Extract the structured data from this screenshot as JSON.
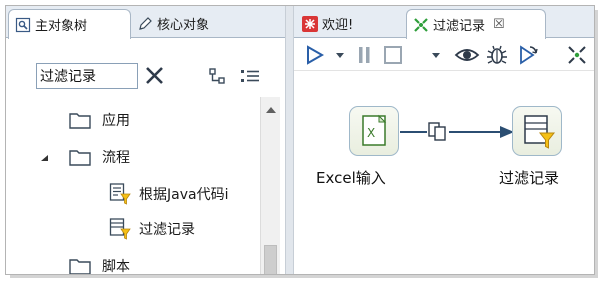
{
  "left_panel": {
    "tabs": [
      {
        "label": "主对象树",
        "icon": "main-tree-icon"
      },
      {
        "label": "核心对象",
        "icon": "pencil-icon"
      }
    ],
    "search": {
      "value": "过滤记录",
      "clear_icon": "close-icon"
    },
    "toolbar_icons": [
      "hierarchy-icon",
      "list-icon"
    ],
    "tree": [
      {
        "label": "应用",
        "icon": "folder-icon"
      },
      {
        "label": "流程",
        "icon": "folder-icon",
        "expanded": true
      },
      {
        "label": "根据Java代码i",
        "icon": "java-filter-step-icon"
      },
      {
        "label": "过滤记录",
        "icon": "filter-rows-step-icon"
      },
      {
        "label": "脚本",
        "icon": "folder-icon"
      }
    ]
  },
  "right_panel": {
    "tabs": [
      {
        "label": "欢迎!",
        "icon": "welcome-icon"
      },
      {
        "label": "过滤记录",
        "icon": "transformation-icon",
        "close_glyph": "☒"
      }
    ],
    "toolbar_icons": [
      "run-icon",
      "run-dropdown-icon",
      "pause-icon",
      "stop-icon",
      "stop-dropdown-icon",
      "preview-icon",
      "debug-icon",
      "replay-icon",
      "explore-icon"
    ],
    "canvas": {
      "steps": [
        {
          "label": "Excel输入",
          "icon": "excel-input-icon"
        },
        {
          "label": "过滤记录",
          "icon": "filter-rows-icon"
        }
      ],
      "hop": {
        "icon": "copy-rows-icon"
      }
    }
  },
  "colors": {
    "tab_bar": "#e6ecf3",
    "accent_blue": "#2a5fa8",
    "hop_arrow": "#2b4e72",
    "excel_green": "#3a7a2a",
    "funnel_yellow": "#f5c016",
    "welcome_red": "#d93636"
  }
}
